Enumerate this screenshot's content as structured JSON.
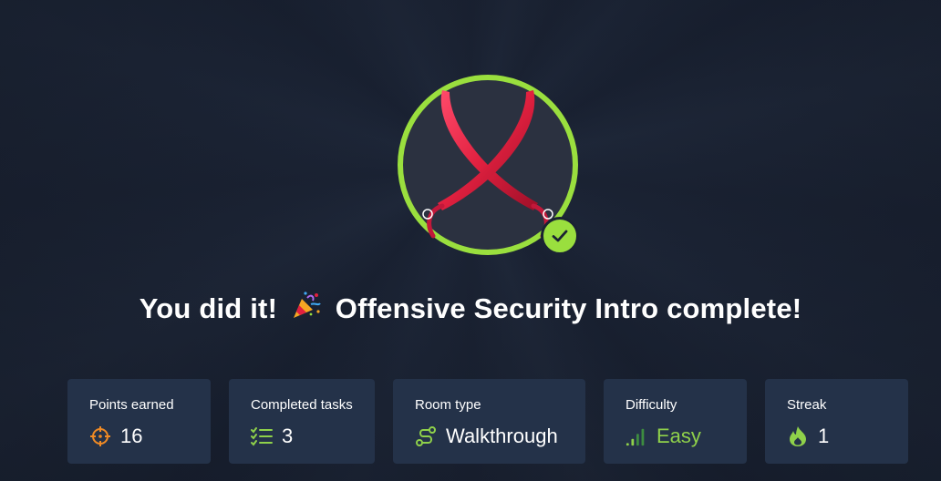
{
  "headline": {
    "prefix": "You did it!",
    "emoji": "🎉",
    "suffix": "Offensive Security Intro complete!"
  },
  "badge": {
    "icon": "crossed-swords-icon",
    "ring_color": "#9adf3e",
    "completed_icon": "checkmark-icon"
  },
  "stats": {
    "points": {
      "label": "Points earned",
      "value": "16",
      "icon": "crosshair-icon"
    },
    "tasks": {
      "label": "Completed tasks",
      "value": "3",
      "icon": "checklist-icon"
    },
    "room_type": {
      "label": "Room type",
      "value": "Walkthrough",
      "icon": "route-icon"
    },
    "difficulty": {
      "label": "Difficulty",
      "value": "Easy",
      "icon": "signal-bars-icon",
      "color": "#8fd14a"
    },
    "streak": {
      "label": "Streak",
      "value": "1",
      "icon": "flame-icon"
    }
  },
  "colors": {
    "accent": "#9adf3e",
    "card": "#243249",
    "orange": "#f08a24",
    "background": "#1a2233"
  }
}
